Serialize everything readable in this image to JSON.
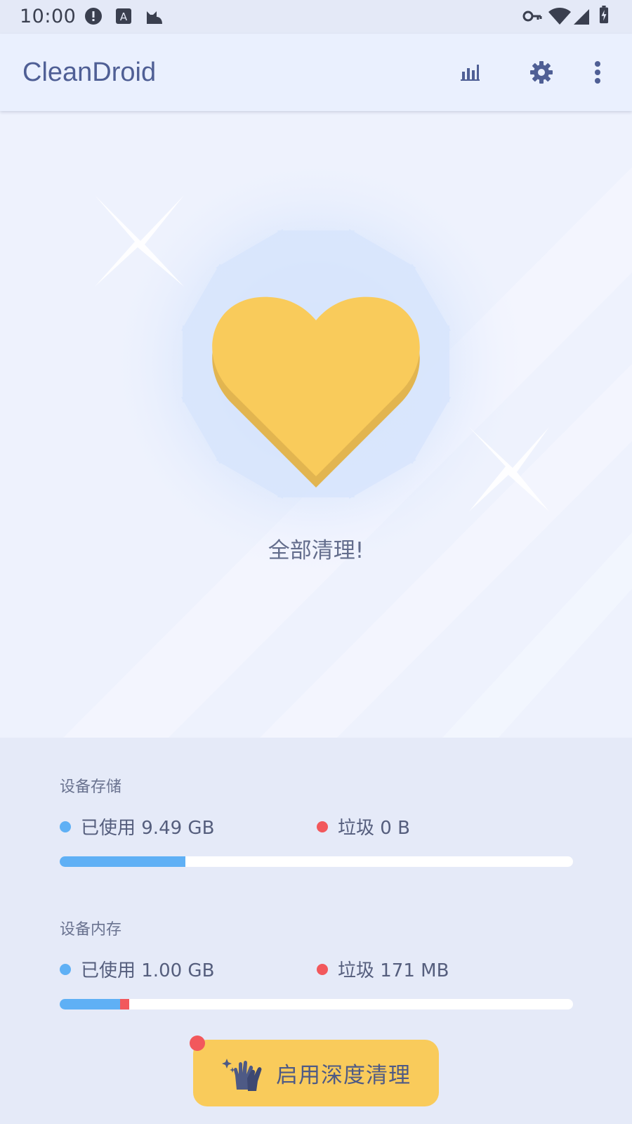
{
  "status_bar": {
    "time": "10:00",
    "left_icons": [
      "alert-icon",
      "a-notification-icon",
      "cat-icon"
    ],
    "right_icons": [
      "vpn-key-icon",
      "wifi-icon",
      "cell-signal-icon",
      "battery-charging-icon"
    ]
  },
  "app_bar": {
    "title": "CleanDroid",
    "actions": [
      "bar-chart-icon",
      "gear-icon",
      "more-vert-icon"
    ]
  },
  "hero": {
    "illustration": "heart-icon",
    "message": "全部清理!"
  },
  "storage": {
    "title": "设备存储",
    "used_label": "已使用 9.49 GB",
    "junk_label": "垃圾 0 B",
    "used_fraction": 0.245,
    "junk_fraction": 0.0
  },
  "memory": {
    "title": "设备内存",
    "used_label": "已使用 1.00 GB",
    "junk_label": "垃圾 171 MB",
    "used_fraction": 0.118,
    "junk_fraction": 0.018
  },
  "deep_clean": {
    "label": "启用深度清理",
    "icon": "cleaning-gloves-icon"
  },
  "colors": {
    "used": "#5fb0f5",
    "junk": "#f2585c",
    "accent": "#f9cb5b",
    "title": "#4f5f95"
  }
}
